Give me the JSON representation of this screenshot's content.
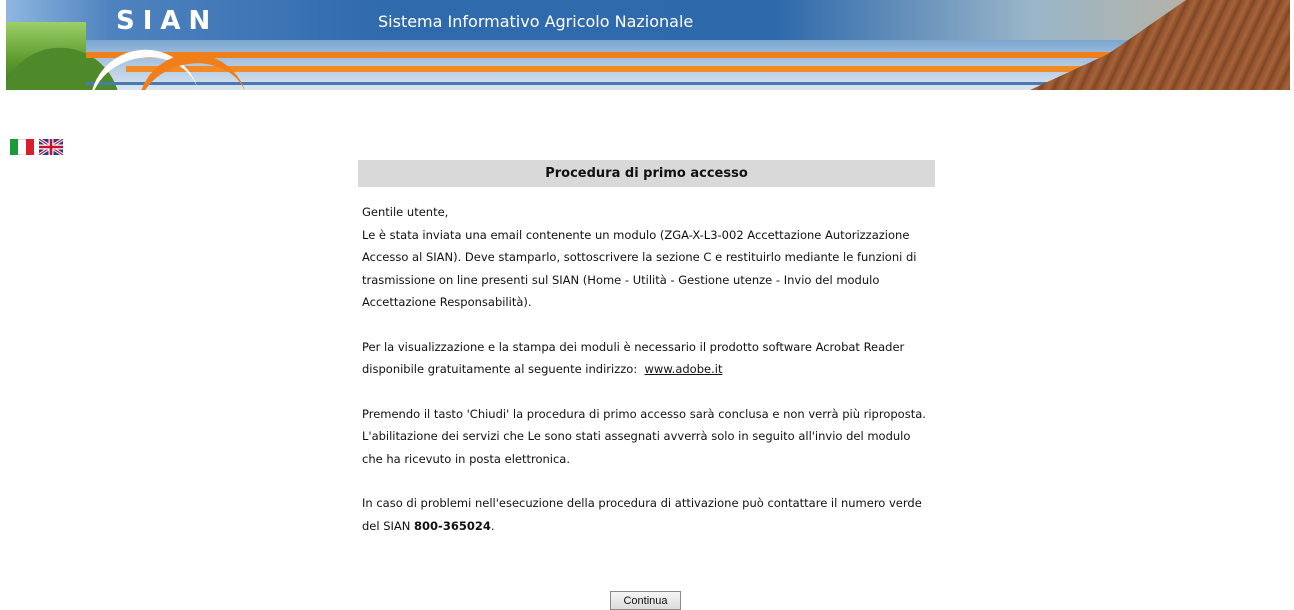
{
  "header": {
    "logo_text": "SIAN",
    "title": "Sistema Informativo Agricolo Nazionale"
  },
  "languages": [
    {
      "name": "italian-flag-icon",
      "code": "it"
    },
    {
      "name": "uk-flag-icon",
      "code": "en"
    }
  ],
  "form": {
    "heading": "Procedura di primo accesso",
    "greeting": "Gentile utente,",
    "p1": "Le è stata inviata una email contenente un modulo (ZGA-X-L3-002 Accettazione Autorizzazione Accesso al SIAN). Deve stamparlo, sottoscrivere la sezione C e restituirlo mediante le funzioni di trasmissione on line presenti sul SIAN (Home - Utilità - Gestione utenze - Invio del modulo Accettazione Responsabilità).",
    "p2": "Per la visualizzazione e la stampa dei moduli è necessario il prodotto software Acrobat Reader disponibile gratuitamente al seguente indirizzo:",
    "p2_link": "www.adobe.it",
    "p3": "Premendo il tasto 'Chiudi' la procedura di primo accesso sarà conclusa e non verrà più riproposta. L'abilitazione dei servizi che Le sono stati assegnati avverrà solo in seguito all'invio del modulo che ha ricevuto in posta elettronica.",
    "p4": "In caso di problemi nell'esecuzione della procedura di attivazione può contattare il numero verde del SIAN",
    "phone": "800-365024",
    "continue_label": "Continua"
  },
  "colors": {
    "banner_orange": "#f07f1b",
    "banner_blue": "#2f6aad",
    "heading_bg": "#d9d9d9"
  }
}
